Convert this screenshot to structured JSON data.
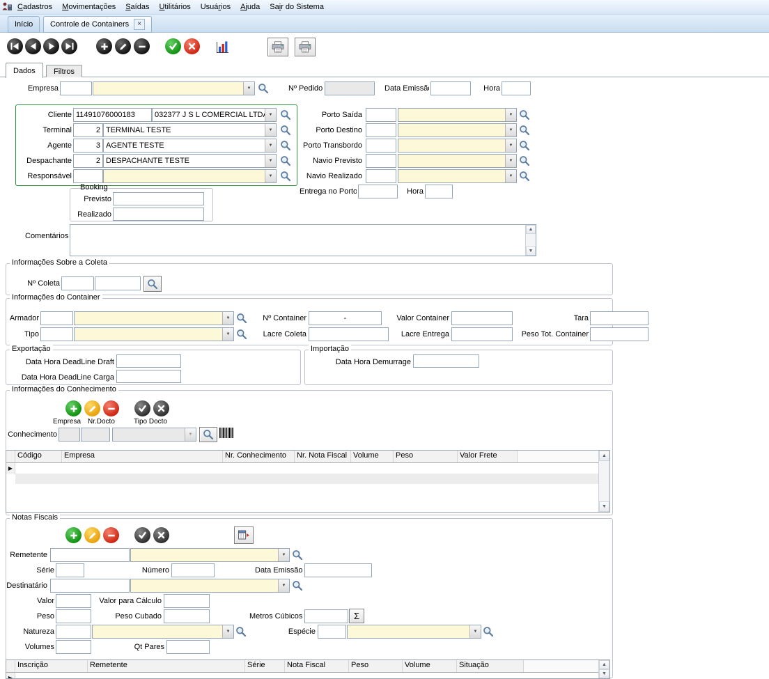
{
  "colors": {
    "menu_bar": "#dce9f7",
    "required_field": "#fdf9d8",
    "add_green": "#14a014",
    "edit_yellow": "#efa308",
    "remove_red": "#d92b18",
    "confirm_green": "#17a017",
    "cancel_red": "#de2b1a",
    "client_box_border": "#2f8f3a"
  },
  "menu": {
    "items": [
      {
        "label": "Cadastros",
        "accel": 0
      },
      {
        "label": "Movimentações",
        "accel": 0
      },
      {
        "label": "Saídas",
        "accel": 0
      },
      {
        "label": "Utilitários",
        "accel": 0
      },
      {
        "label": "Usuários",
        "accel": 4
      },
      {
        "label": "Ajuda",
        "accel": 0
      },
      {
        "label": "Sair do Sistema",
        "accel": 2
      }
    ]
  },
  "tabs": {
    "inicio": "Início",
    "controle": "Controle de Containers"
  },
  "page_tabs": {
    "dados": "Dados",
    "filtros": "Filtros"
  },
  "header": {
    "empresa": "Empresa",
    "pedido": "Nº Pedido",
    "data_emissao": "Data Emissão",
    "hora": "Hora"
  },
  "cliente": {
    "cliente_label": "Cliente",
    "cliente_code": "11491076000183",
    "cliente_name": "032377  J S L COMERCIAL LTDA",
    "terminal_label": "Terminal",
    "terminal_code": "2",
    "terminal_name": "TERMINAL TESTE",
    "agente_label": "Agente",
    "agente_code": "3",
    "agente_name": "AGENTE TESTE",
    "despachante_label": "Despachante",
    "despachante_code": "2",
    "despachante_name": "DESPACHANTE TESTE",
    "responsavel_label": "Responsável"
  },
  "portos": {
    "saida": "Porto Saída",
    "destino": "Porto Destino",
    "transbordo": "Porto Transbordo",
    "navio_previsto": "Navio Previsto",
    "navio_realizado": "Navio Realizado"
  },
  "booking": {
    "title": "Booking",
    "previsto": "Previsto",
    "realizado": "Realizado"
  },
  "entrega": {
    "label": "Entrega no Porto",
    "hora": "Hora"
  },
  "comentarios": {
    "label": "Comentários"
  },
  "coleta": {
    "title": "Informações Sobre a Coleta",
    "n_coleta": "Nº Coleta"
  },
  "container": {
    "title": "Informações do Container",
    "armador": "Armador",
    "tipo": "Tipo",
    "n_container": "Nº Container",
    "n_container_value": "-",
    "valor_container": "Valor Container",
    "tara": "Tara",
    "lacre_coleta": "Lacre Coleta",
    "lacre_entrega": "Lacre Entrega",
    "peso_tot": "Peso Tot. Container"
  },
  "exportacao": {
    "title": "Exportação",
    "draft": "Data Hora DeadLine Draft",
    "carga": "Data Hora DeadLine Carga"
  },
  "importacao": {
    "title": "Importação",
    "demurrage": "Data Hora Demurrage"
  },
  "conhecimento": {
    "title": "Informações do Conhecimento",
    "empresa": "Empresa",
    "nr_docto": "Nr.Docto",
    "tipo_docto": "Tipo Docto",
    "label": "Conhecimento",
    "grid_columns": [
      "Código",
      "Empresa",
      "Nr. Conhecimento",
      "Nr. Nota Fiscal",
      "Volume",
      "Peso",
      "Valor Frete"
    ]
  },
  "notas": {
    "title": "Notas Fiscais",
    "remetente": "Remetente",
    "serie": "Série",
    "numero": "Número",
    "data_emissao": "Data Emissão",
    "destinatario": "Destinatário",
    "valor": "Valor",
    "valor_calculo": "Valor para Cálculo",
    "peso": "Peso",
    "peso_cubado": "Peso Cubado",
    "metros_cubicos": "Metros Cúbicos",
    "sigma": "Σ",
    "natureza": "Natureza",
    "especie": "Espécie",
    "volumes": "Volumes",
    "qt_pares": "Qt Pares",
    "grid_columns": [
      "Inscrição",
      "Remetente",
      "Série",
      "Nota Fiscal",
      "Peso",
      "Volume",
      "Situação"
    ]
  }
}
